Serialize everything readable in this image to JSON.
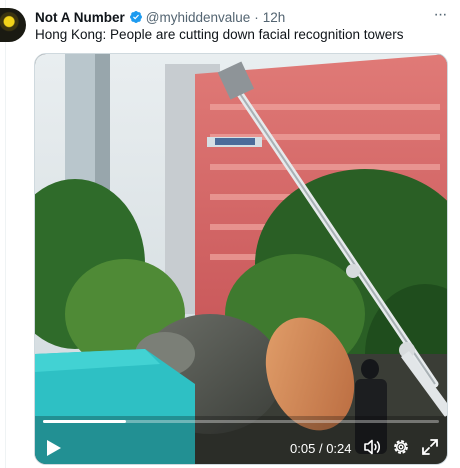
{
  "tweet": {
    "author_name": "Not A Number",
    "handle": "@myhiddenvalue",
    "separator": "·",
    "time_ago": "12h",
    "text": "Hong Kong: People are cutting down facial recognition towers",
    "more_label": "···"
  },
  "video": {
    "current_time": "0:05",
    "time_separator": "/",
    "duration": "0:24",
    "progress_fraction": 0.21
  },
  "colors": {
    "verified_blue": "#1d9bf0",
    "secondary_text": "#536471"
  },
  "icons": {
    "verified": "verified-badge-icon",
    "more": "more-horizontal-icon",
    "play": "play-icon",
    "volume": "volume-icon",
    "settings": "gear-icon",
    "fullscreen": "fullscreen-icon"
  }
}
